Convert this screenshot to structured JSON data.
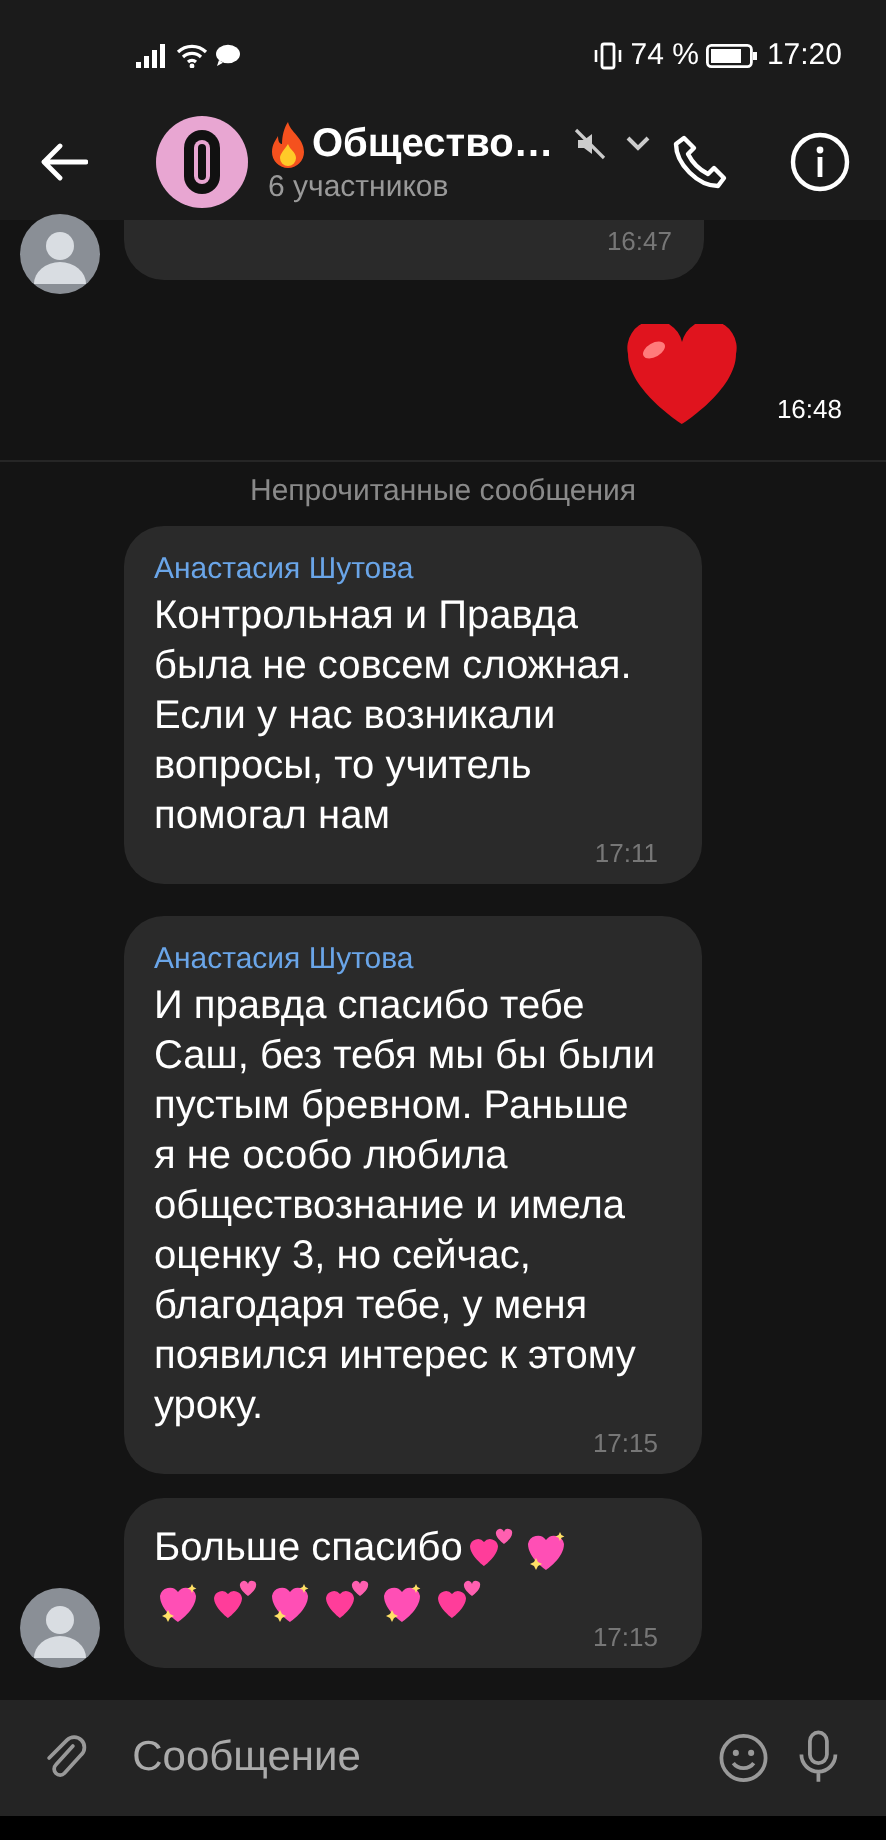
{
  "status_bar": {
    "battery_text": "74 %",
    "time": "17:20"
  },
  "header": {
    "title": "Общество…",
    "subtitle": "6 участников",
    "muted": true
  },
  "messages": [
    {
      "kind": "partial",
      "time": "16:47"
    },
    {
      "kind": "big-heart",
      "time": "16:48"
    },
    {
      "kind": "divider",
      "label": "Непрочитанные сообщения"
    },
    {
      "kind": "text",
      "author": "Анастасия Шутова",
      "text": "Контрольная и Правда была не совсем сложная. Если у нас возникали вопросы, то учитель помогал нам",
      "time": "17:11"
    },
    {
      "kind": "text",
      "author": "Анастасия Шутова",
      "text": "И правда спасибо тебе Саш, без тебя мы бы были пустым бревном. Раньше я не особо любила обществознание и имела оценку 3, но сейчас, благодаря тебе, у меня появился интерес к этому уроку.",
      "time": "17:15"
    },
    {
      "kind": "text",
      "text": "Больше спасибо",
      "hearts": [
        {
          "kind": "two-hearts"
        },
        {
          "kind": "sparkling-heart"
        },
        {
          "kind": "sparkling-heart"
        },
        {
          "kind": "two-hearts"
        },
        {
          "kind": "sparkling-heart"
        },
        {
          "kind": "two-hearts"
        },
        {
          "kind": "sparkling-heart"
        },
        {
          "kind": "two-hearts"
        }
      ],
      "time": "17:15"
    }
  ],
  "composer": {
    "placeholder": "Сообщение"
  }
}
